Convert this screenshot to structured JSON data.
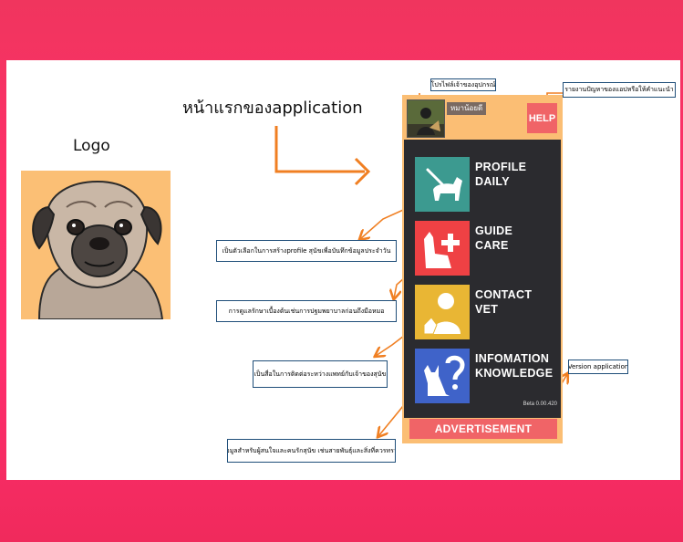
{
  "logo": {
    "title": "Logo"
  },
  "heading": "หน้าแรกของapplication",
  "notes": {
    "profile": "โปรไฟล์เจ้าของอุปกรณ์",
    "help": "รายงานปัญหาของแอปหรือให้คำแนะนำ",
    "daily": "เป็นตัวเลือกในการสร้างprofile สุนัขเพื่อบันทึกข้อมูลประจำวัน",
    "guide": "การดูแลรักษาเบื้องต้นเช่นการปฐมพยาบาลก่อนถึงมือหมอ",
    "contact": "เป็นสื่อในการติดต่อระหว่างแพทย์กับเจ้าของสุนัข",
    "info": "ข้อมูลสำหรับผู้สนใจและคนรักสุนัข เช่นสายพันธุ์และสิ่งที่ควรทราบ",
    "version": "Version application"
  },
  "app": {
    "user_tag": "หมาน้อยดี",
    "help": "HELP",
    "menu": [
      {
        "line1": "PROFILE",
        "line2": "DAILY",
        "color": "#3c9a90"
      },
      {
        "line1": "GUIDE",
        "line2": "CARE",
        "color": "#ef4144"
      },
      {
        "line1": "CONTACT",
        "line2": "VET",
        "color": "#e9b634"
      },
      {
        "line1": "INFOMATION",
        "line2": "KNOWLEDGE",
        "color": "#3f63c9"
      }
    ],
    "version": "Beta 0.00.420",
    "advertisement": "ADVERTISEMENT"
  },
  "colors": {
    "accent": "#f06467",
    "phone_frame": "#fbbe74",
    "arrow": "#f07f22",
    "note_border": "#1f4e79"
  }
}
